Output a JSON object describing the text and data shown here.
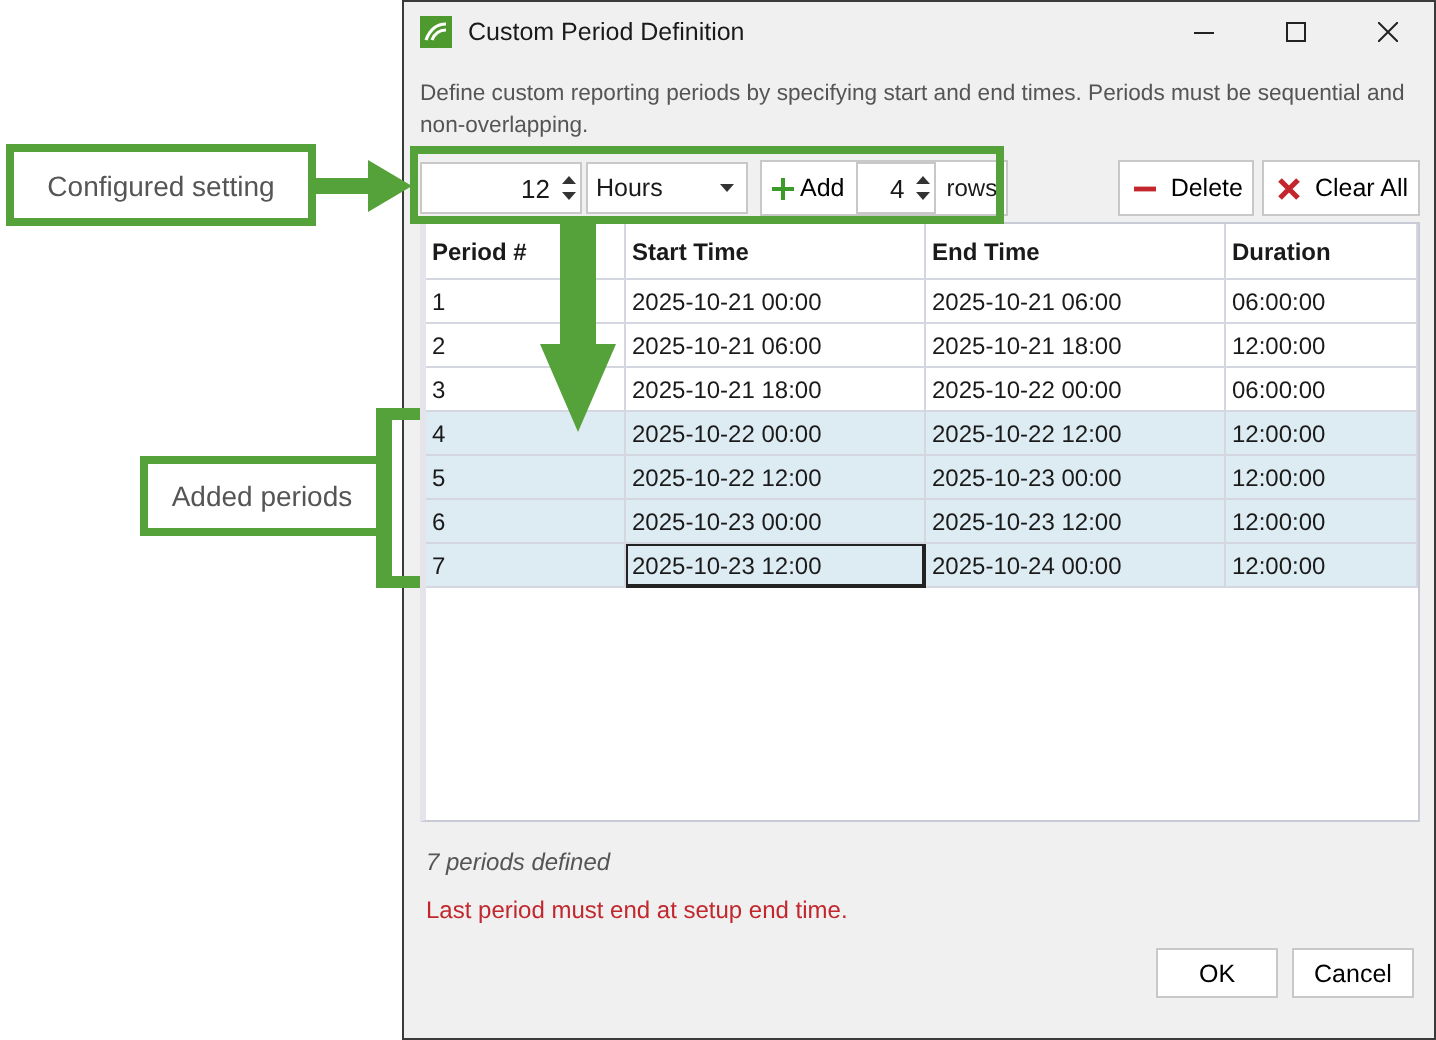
{
  "annotations": [
    {
      "kind": "label",
      "text": "Configured setting"
    },
    {
      "kind": "label",
      "text": "Added periods"
    }
  ],
  "window": {
    "title": "Custom Period Definition"
  },
  "description": "Define custom reporting periods by specifying start and end times. Periods must be sequential and non-overlapping.",
  "toolbar": {
    "interval": {
      "value": "12"
    },
    "unit": {
      "value": "Hours"
    },
    "add_button": {
      "label": "Add"
    },
    "add_count": {
      "value": "4"
    },
    "rows_label": "rows",
    "delete_button": {
      "label": "Delete"
    },
    "clear_button": {
      "label": "Clear All"
    }
  },
  "table": {
    "columns": [
      "Period #",
      "Start Time",
      "End Time",
      "Duration"
    ],
    "rows": [
      {
        "selected": false,
        "cells": [
          {
            "text": "1",
            "focused": false
          },
          {
            "text": "2025-10-21 00:00",
            "focused": false
          },
          {
            "text": "2025-10-21 06:00",
            "focused": false
          },
          {
            "text": "06:00:00",
            "focused": false
          }
        ]
      },
      {
        "selected": false,
        "cells": [
          {
            "text": "2",
            "focused": false
          },
          {
            "text": "2025-10-21 06:00",
            "focused": false
          },
          {
            "text": "2025-10-21 18:00",
            "focused": false
          },
          {
            "text": "12:00:00",
            "focused": false
          }
        ]
      },
      {
        "selected": false,
        "cells": [
          {
            "text": "3",
            "focused": false
          },
          {
            "text": "2025-10-21 18:00",
            "focused": false
          },
          {
            "text": "2025-10-22 00:00",
            "focused": false
          },
          {
            "text": "06:00:00",
            "focused": false
          }
        ]
      },
      {
        "selected": true,
        "cells": [
          {
            "text": "4",
            "focused": false
          },
          {
            "text": "2025-10-22 00:00",
            "focused": false
          },
          {
            "text": "2025-10-22 12:00",
            "focused": false
          },
          {
            "text": "12:00:00",
            "focused": false
          }
        ]
      },
      {
        "selected": true,
        "cells": [
          {
            "text": "5",
            "focused": false
          },
          {
            "text": "2025-10-22 12:00",
            "focused": false
          },
          {
            "text": "2025-10-23 00:00",
            "focused": false
          },
          {
            "text": "12:00:00",
            "focused": false
          }
        ]
      },
      {
        "selected": true,
        "cells": [
          {
            "text": "6",
            "focused": false
          },
          {
            "text": "2025-10-23 00:00",
            "focused": false
          },
          {
            "text": "2025-10-23 12:00",
            "focused": false
          },
          {
            "text": "12:00:00",
            "focused": false
          }
        ]
      },
      {
        "selected": true,
        "cells": [
          {
            "text": "7",
            "focused": false
          },
          {
            "text": "2025-10-23 12:00",
            "focused": true
          },
          {
            "text": "2025-10-24 00:00",
            "focused": false
          },
          {
            "text": "12:00:00",
            "focused": false
          }
        ]
      }
    ]
  },
  "status": "7 periods defined",
  "error": "Last period must end at setup end time.",
  "buttons": [
    "OK",
    "Cancel"
  ]
}
